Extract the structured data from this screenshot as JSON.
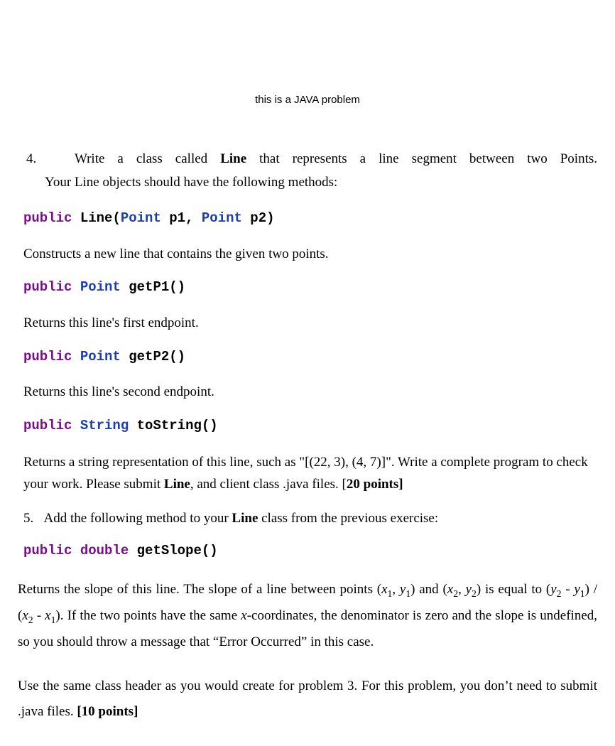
{
  "title": "this is a JAVA problem",
  "q4": {
    "number": "4.",
    "head_pre": "Write a class called",
    "class_name": "Line",
    "head_post": "that represents a line segment between two Points.",
    "sub": "Your Line objects should have the following methods:"
  },
  "code": {
    "kw_public": "public",
    "type_point": "Point",
    "type_string": "String",
    "type_double": "double",
    "ctor_name": "Line",
    "ctor_params_open": "(",
    "ctor_p1": " p1, ",
    "ctor_p2": " p2)",
    "getP1": " getP1()",
    "getP2": " getP2()",
    "toString": " toString()",
    "getSlope": " getSlope()"
  },
  "desc": {
    "ctor": "Constructs a new line that contains the given two points.",
    "getP1": "Returns this line's first endpoint.",
    "getP2": "Returns this line's second endpoint.",
    "toString_pre": "Returns a string representation of this line, such as \"[(22, 3), (4, 7)]\". Write a complete program to check your work. Please submit ",
    "toString_bold1": "Line",
    "toString_mid": ", and client class .java files.  [",
    "toString_bold2": "20 points",
    "toString_end": "]"
  },
  "q5": {
    "number": "5.",
    "pre": "Add the following method to your ",
    "bold": "Line",
    "post": " class from the previous exercise:"
  },
  "slope": {
    "pre": "Returns the slope of this line. The slope of a line between points (",
    "x": "x",
    "y": "y",
    "s1": "1",
    "s2": "2",
    "and": ") and (",
    "eq": ") is equal to (",
    "minus": " - ",
    "div": ") / (",
    "close": "). If the two points have the same ",
    "post": "-coordinates, the denominator is zero and the slope is undefined, so you should throw a message that “Error Occurred” in this case."
  },
  "final": {
    "pre": "Use the same class header as you would create for problem 3. For this problem, you don’t need to submit .java files.  ",
    "bold": "[10 points]"
  }
}
